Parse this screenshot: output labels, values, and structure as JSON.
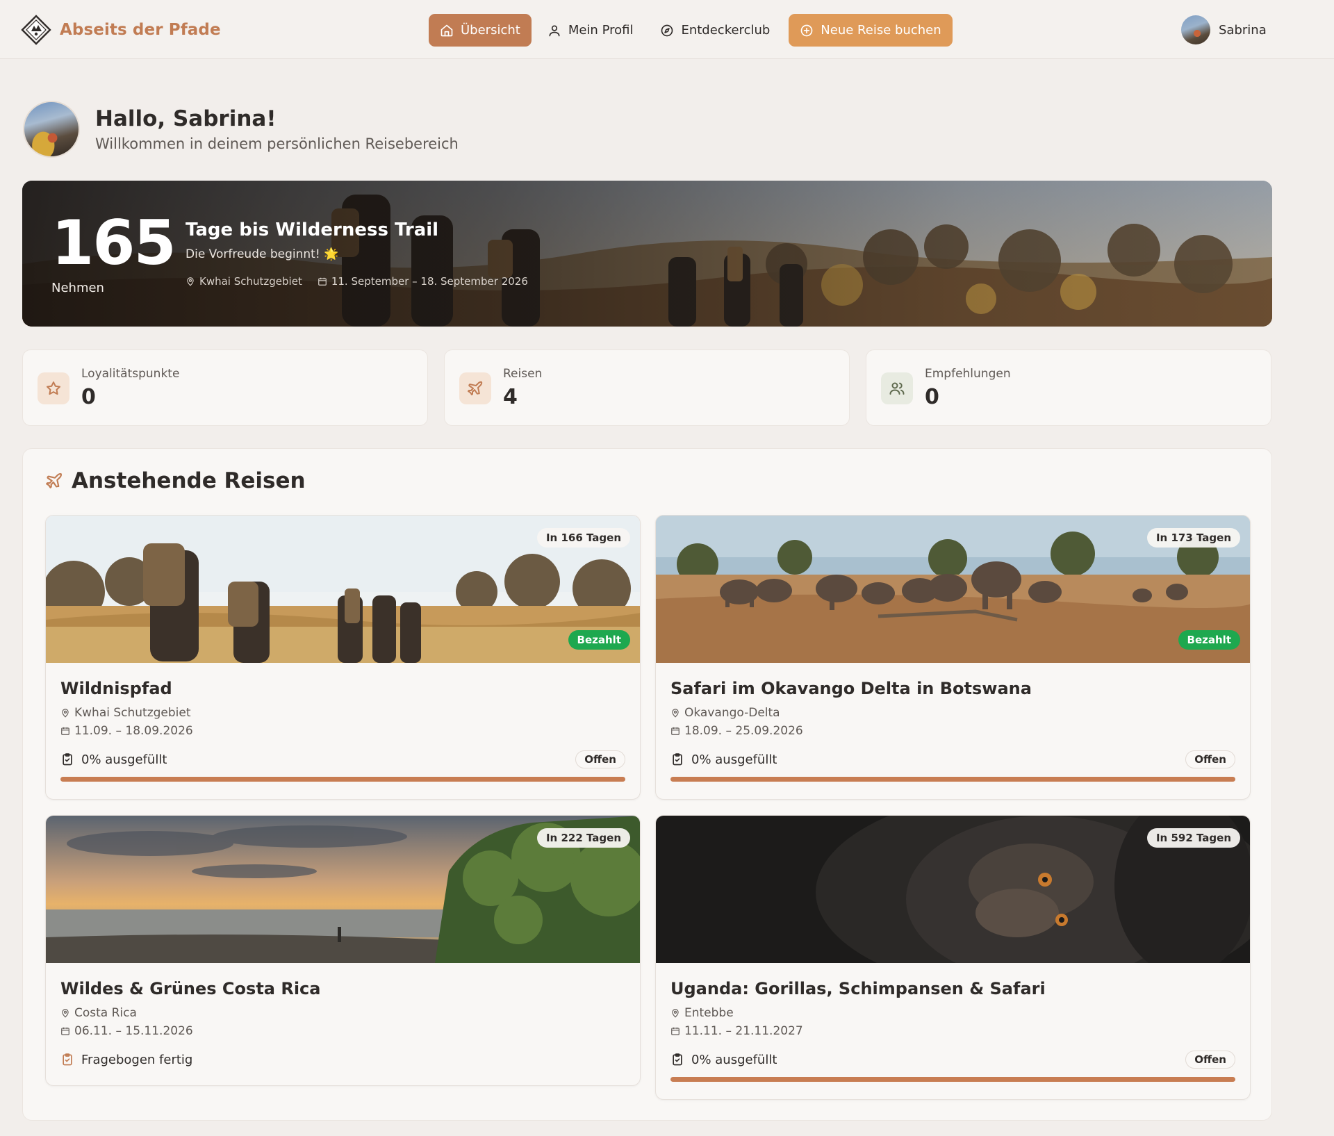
{
  "brand": {
    "name": "Abseits der Pfade"
  },
  "nav": {
    "items": [
      {
        "label": "Übersicht",
        "icon": "home-icon",
        "active": true
      },
      {
        "label": "Mein Profil",
        "icon": "user-icon",
        "active": false
      },
      {
        "label": "Entdeckerclub",
        "icon": "compass-icon",
        "active": false
      }
    ],
    "cta": {
      "label": "Neue Reise buchen",
      "icon": "plus-circle-icon"
    }
  },
  "user": {
    "name": "Sabrina"
  },
  "greeting": {
    "title": "Hallo, Sabrina!",
    "subtitle": "Willkommen in deinem persönlichen Reisebereich"
  },
  "hero": {
    "days": "165",
    "days_label": "Nehmen",
    "title": "Tage bis Wilderness Trail",
    "subtitle": "Die Vorfreude beginnt! 🌟",
    "location": "Kwhai Schutzgebiet",
    "dates": "11. September – 18. September 2026"
  },
  "stats": [
    {
      "label": "Loyalitätspunkte",
      "value": "0",
      "icon": "star-icon"
    },
    {
      "label": "Reisen",
      "value": "4",
      "icon": "plane-icon"
    },
    {
      "label": "Empfehlungen",
      "value": "0",
      "icon": "users-icon"
    }
  ],
  "trips_section": {
    "title": "Anstehende Reisen"
  },
  "trips": [
    {
      "title": "Wildnispfad",
      "location": "Kwhai Schutzgebiet",
      "dates": "11.09. – 18.09.2026",
      "days_badge": "In 166 Tagen",
      "paid_badge": "Bezahlt",
      "progress_text": "0% ausgefüllt",
      "progress": 0,
      "status": "Offen",
      "scene": "hikers"
    },
    {
      "title": "Safari im Okavango Delta in Botswana",
      "location": "Okavango-Delta",
      "dates": "18.09. – 25.09.2026",
      "days_badge": "In 173 Tagen",
      "paid_badge": "Bezahlt",
      "progress_text": "0% ausgefüllt",
      "progress": 0,
      "status": "Offen",
      "scene": "elephants"
    },
    {
      "title": "Wildes & Grünes Costa Rica",
      "location": "Costa Rica",
      "dates": "06.11. – 15.11.2026",
      "days_badge": "In 222 Tagen",
      "progress_text": "Fragebogen fertig",
      "scene": "beach"
    },
    {
      "title": "Uganda: Gorillas, Schimpansen & Safari",
      "location": "Entebbe",
      "dates": "11.11. – 21.11.2027",
      "days_badge": "In 592 Tagen",
      "progress_text": "0% ausgefüllt",
      "progress": 0,
      "status": "Offen",
      "scene": "chimp"
    }
  ],
  "colors": {
    "accent": "#c17c53",
    "cta": "#df9a58",
    "paid": "#1ea84f",
    "background": "#f2eeeb"
  }
}
